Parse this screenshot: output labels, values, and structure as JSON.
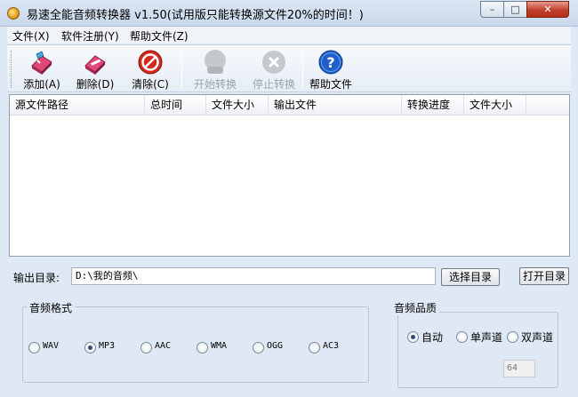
{
  "window": {
    "title": "易速全能音频转换器 v1.50(试用版只能转换源文件20%的时间！)"
  },
  "menu": [
    {
      "label": "文件(X)"
    },
    {
      "label": "软件注册(Y)"
    },
    {
      "label": "帮助文件(Z)"
    }
  ],
  "toolbar": {
    "add": "添加(A)",
    "delete": "删除(D)",
    "clear": "清除(C)",
    "start": "开始转换",
    "stop": "停止转换",
    "help": "帮助文件"
  },
  "list": {
    "columns": [
      "源文件路径",
      "总时间",
      "文件大小",
      "输出文件",
      "转换进度",
      "文件大小"
    ],
    "rows": []
  },
  "output": {
    "label": "输出目录:",
    "value": "D:\\我的音频\\",
    "choose_button": "选择目录",
    "open_button": "打开目录"
  },
  "format": {
    "title": "音频格式",
    "options": [
      "WAV",
      "MP3",
      "AAC",
      "WMA",
      "OGG",
      "AC3"
    ],
    "selected": "MP3"
  },
  "quality": {
    "title": "音频品质",
    "options": [
      "自动",
      "单声道",
      "双声道"
    ],
    "selected": "自动",
    "bitrate": "64"
  },
  "colors": {
    "help_blue": "#1f5fc8",
    "danger_red": "#d22a1e",
    "accent_pink": "#e0487a"
  }
}
